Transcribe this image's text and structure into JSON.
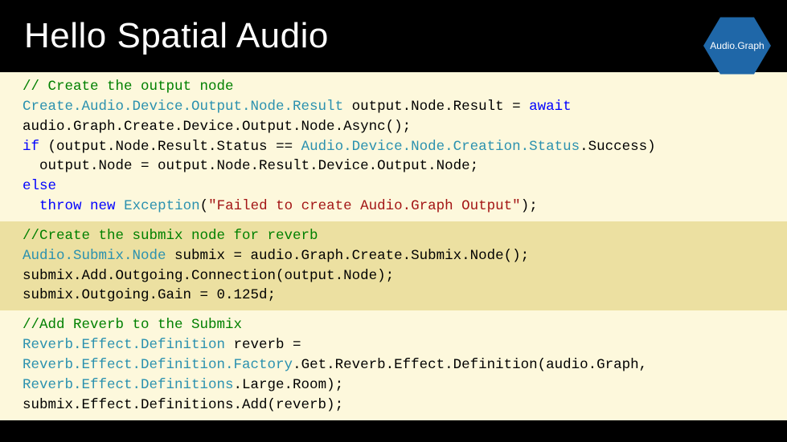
{
  "header": {
    "title": "Hello Spatial Audio",
    "badge": "Audio.Graph"
  },
  "code": {
    "block1": {
      "comment": "// Create the output node",
      "type1": "Create.Audio.Device.Output.Node.Result",
      "line2_rest": " output.Node.Result = ",
      "kw_await": "await",
      "line3": "audio.Graph.Create.Device.Output.Node.Async();",
      "kw_if": "if",
      "line4_after_if": " (output.Node.Result.Status == ",
      "type2": "Audio.Device.Node.Creation.Status",
      "line4_end": ".Success)",
      "line5": "  output.Node = output.Node.Result.Device.Output.Node;",
      "kw_else": "else",
      "line7_pre": "  ",
      "kw_throw": "throw",
      "kw_new": "new",
      "type_exc": "Exception",
      "paren_open": "(",
      "str": "\"Failed to create Audio.Graph Output\"",
      "paren_close": ");"
    },
    "block2": {
      "comment": "//Create the submix node for reverb",
      "type1": "Audio.Submix.Node",
      "line2_rest": " submix = audio.Graph.Create.Submix.Node();",
      "line3": "submix.Add.Outgoing.Connection(output.Node);",
      "line4": "submix.Outgoing.Gain = 0.125d;"
    },
    "block3": {
      "comment": "//Add Reverb to the Submix",
      "type1": "Reverb.Effect.Definition",
      "line2_rest": " reverb =",
      "type2": "Reverb.Effect.Definition.Factory",
      "line3_rest": ".Get.Reverb.Effect.Definition(audio.Graph,",
      "type3": "Reverb.Effect.Definitions",
      "line4_rest": ".Large.Room);",
      "line5": "submix.Effect.Definitions.Add(reverb);"
    }
  }
}
